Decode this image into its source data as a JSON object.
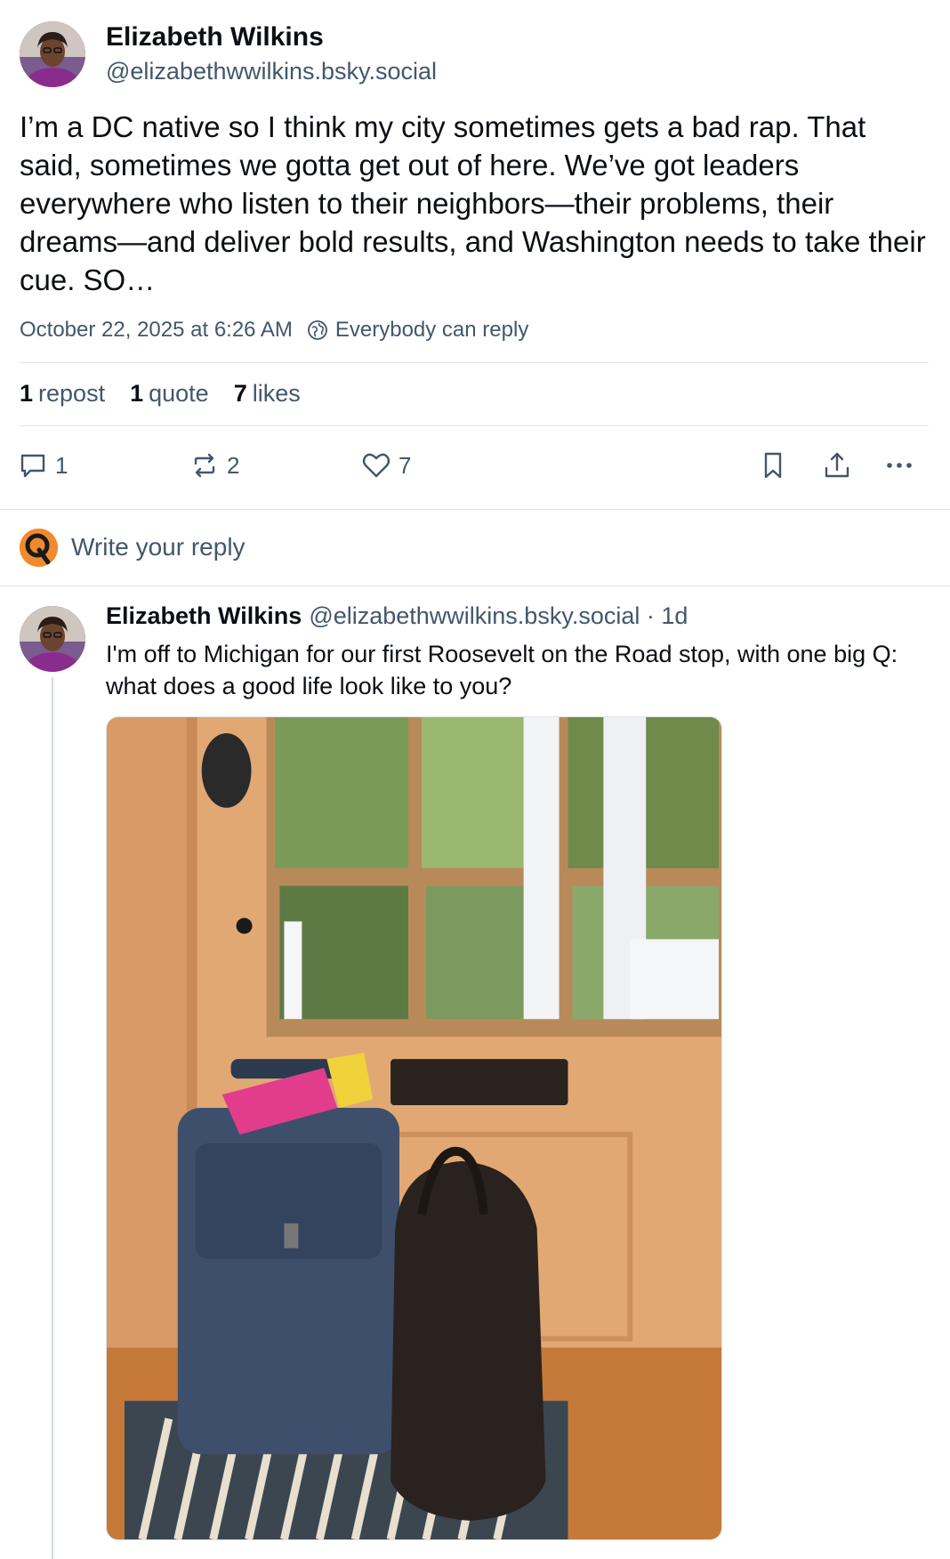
{
  "main_post": {
    "author_name": "Elizabeth Wilkins",
    "author_handle": "@elizabethwwilkins.bsky.social",
    "text": "I’m a DC native so I think my city sometimes gets a bad rap. That said, sometimes we gotta get out of here. We’ve got leaders everywhere who listen to their neighbors—their problems, their dreams—and deliver bold results, and Washington needs to take their cue. SO…",
    "timestamp": "October 22, 2025 at 6:26 AM",
    "reply_setting": "Everybody can reply",
    "stats": {
      "reposts_count": "1",
      "reposts_label": "repost",
      "quotes_count": "1",
      "quotes_label": "quote",
      "likes_count": "7",
      "likes_label": "likes"
    },
    "actions": {
      "reply_count": "1",
      "repost_count": "2",
      "like_count": "7"
    }
  },
  "reply_bar": {
    "placeholder": "Write your reply"
  },
  "parent_post": {
    "author_name": "Elizabeth Wilkins",
    "author_handle": "@elizabethwwilkins.bsky.social",
    "time_ago": "· 1d",
    "text": "I'm off to Michigan for our first Roosevelt on the Road stop, with one big Q: what does a good life look like to you?"
  },
  "icons": {
    "reply": "speech-bubble-icon",
    "repost": "repost-arrows-icon",
    "like": "heart-icon",
    "bookmark": "bookmark-icon",
    "share": "share-icon",
    "more": "ellipsis-icon",
    "reply_setting": "globe-icon"
  },
  "colors": {
    "text": "#0b0f14",
    "muted": "#42576c",
    "divider": "#dfe4ea"
  }
}
